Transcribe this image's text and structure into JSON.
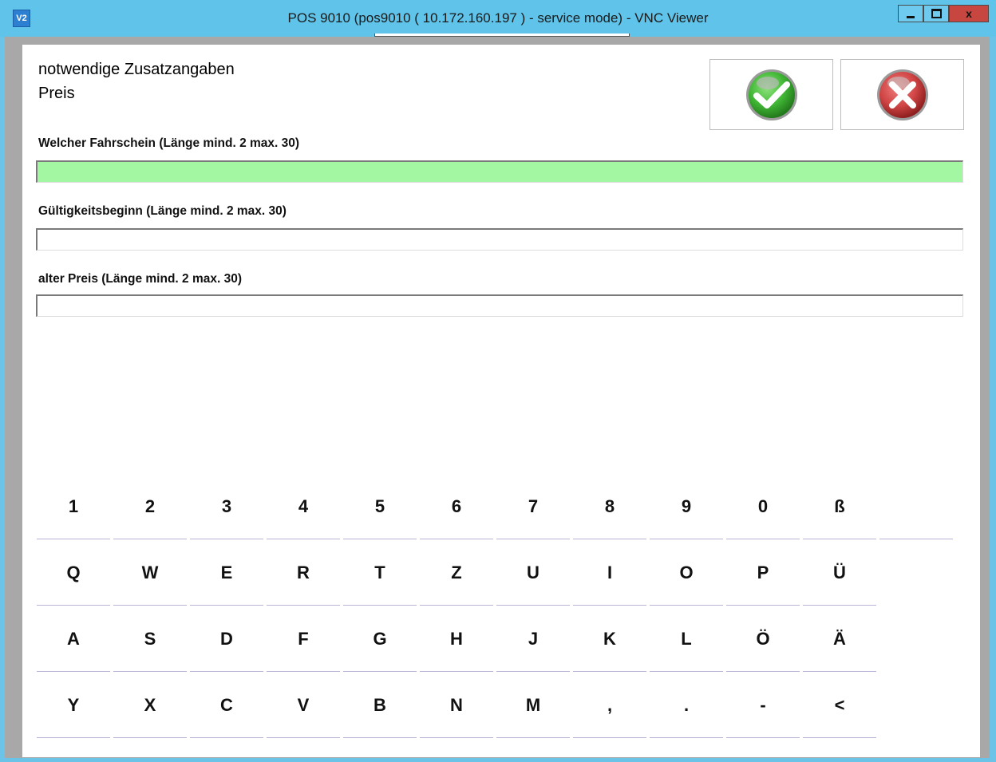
{
  "window": {
    "app_icon_text": "V2",
    "title": "POS 9010 (pos9010 ( 10.172.160.197 ) - service mode) - VNC Viewer",
    "close_glyph": "x"
  },
  "dialog": {
    "heading": "notwendige Zusatzangaben",
    "subheading": "Preis",
    "ok_icon": "green-check-icon",
    "cancel_icon": "red-x-icon",
    "colors": {
      "active_field": "#a3f7a3",
      "ok_green": "#4cc23e",
      "cancel_red": "#d04a4a"
    }
  },
  "fields": [
    {
      "label": "Welcher Fahrschein (Länge mind. 2 max. 30)",
      "value": ""
    },
    {
      "label": "Gültigkeitsbeginn (Länge mind. 2 max. 30)",
      "value": ""
    },
    {
      "label": "alter Preis (Länge mind. 2 max. 30)",
      "value": ""
    }
  ],
  "keyboard": {
    "rows": [
      [
        "1",
        "2",
        "3",
        "4",
        "5",
        "6",
        "7",
        "8",
        "9",
        "0",
        "ß",
        ""
      ],
      [
        "Q",
        "W",
        "E",
        "R",
        "T",
        "Z",
        "U",
        "I",
        "O",
        "P",
        "Ü"
      ],
      [
        "A",
        "S",
        "D",
        "F",
        "G",
        "H",
        "J",
        "K",
        "L",
        "Ö",
        "Ä"
      ],
      [
        "Y",
        "X",
        "C",
        "V",
        "B",
        "N",
        "M",
        ",",
        ".",
        "-",
        "<"
      ]
    ]
  }
}
